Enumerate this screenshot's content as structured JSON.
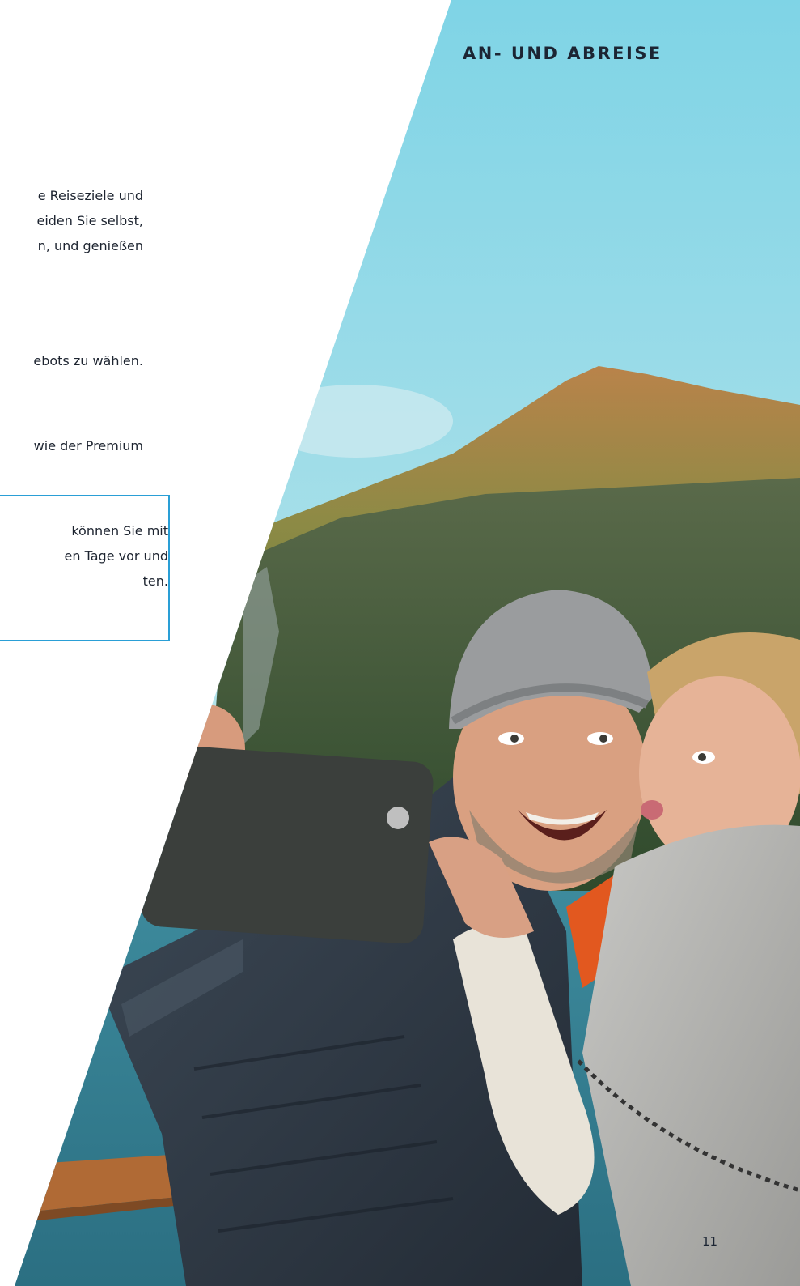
{
  "header": {
    "section_title": "AN- UND ABREISE"
  },
  "content": {
    "paragraph_1": [
      "e Reiseziele und",
      "eiden Sie selbst,",
      "n, und genießen"
    ],
    "paragraph_2": [
      "ebots zu wählen."
    ],
    "paragraph_3": [
      "wie der Premium"
    ],
    "info_box": [
      "können Sie mit",
      "en Tage vor und",
      "ten."
    ]
  },
  "photo": {
    "description_icon": "couple-selfie-photo"
  },
  "footer": {
    "page_number": "11"
  },
  "colors": {
    "accent_border": "#2a9fd6",
    "text": "#1d2430"
  }
}
